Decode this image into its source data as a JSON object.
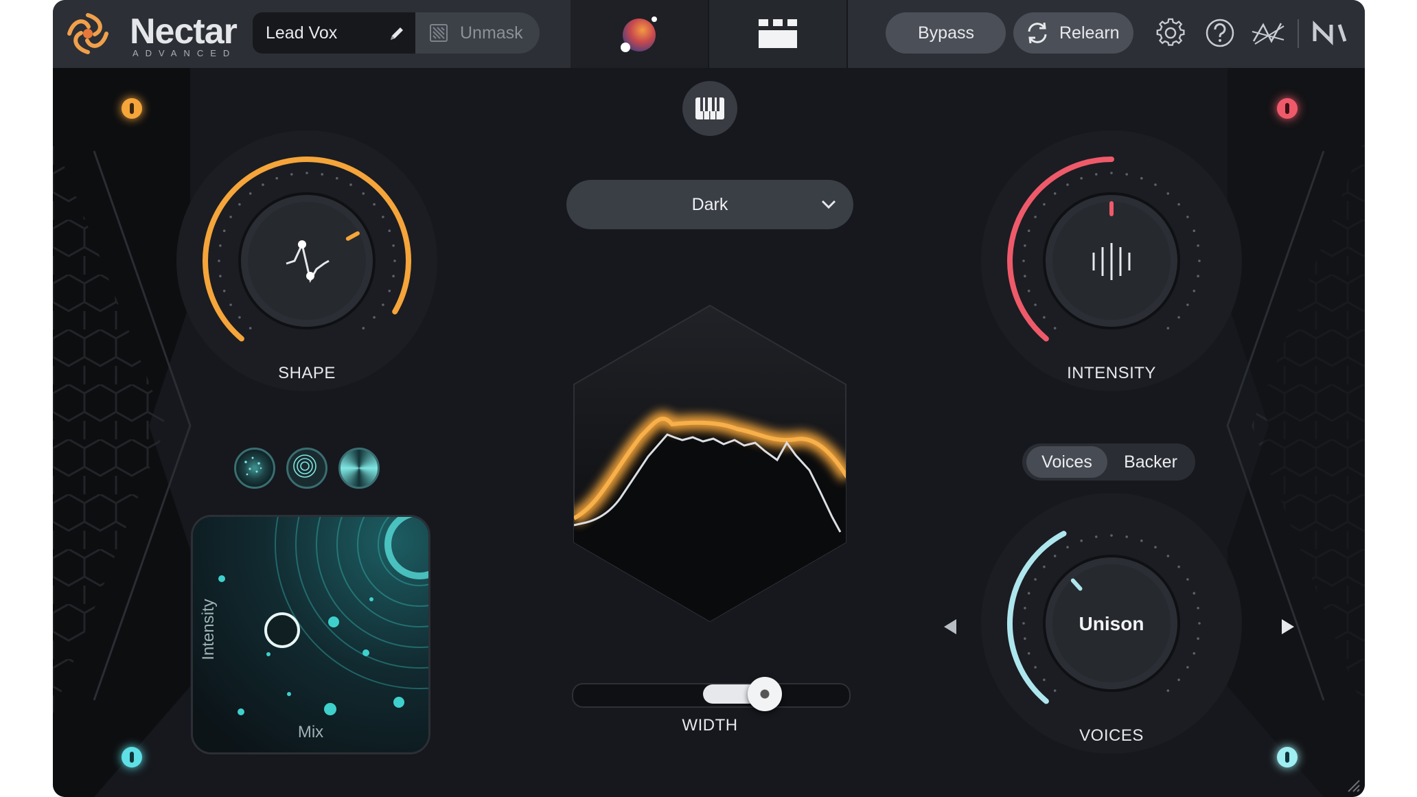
{
  "header": {
    "logo_name": "Nectar",
    "logo_sub": "ADVANCED",
    "preset_name": "Lead Vox",
    "unmask_label": "Unmask",
    "bypass_label": "Bypass",
    "relearn_label": "Relearn",
    "icons": [
      "edit-pencil-icon",
      "unmask-icon",
      "assistant-orb-icon",
      "module-grid-icon",
      "relearn-cycle-icon",
      "gear-icon",
      "help-icon",
      "midi-learn-icon",
      "native-instruments-logo"
    ]
  },
  "shape": {
    "label": "SHAPE",
    "value_fraction": 0.72,
    "color": "#f5a53a"
  },
  "intensity": {
    "label": "INTENSITY",
    "value_fraction": 0.5,
    "color": "#ef5a6a"
  },
  "style": {
    "selected": "Dark"
  },
  "width": {
    "label": "WIDTH",
    "value_fraction": 0.7
  },
  "voices_mode": {
    "options": [
      "Voices",
      "Backer"
    ],
    "selected": "Voices"
  },
  "voices": {
    "label": "VOICES",
    "value": "Unison",
    "value_fraction": 0.35,
    "color": "#aee6ee"
  },
  "xy_pad": {
    "y_label": "Intensity",
    "x_label": "Mix",
    "accent": "#3fd0cc"
  },
  "colors": {
    "corner_top_left": "#f5a53a",
    "corner_top_right": "#ef5a6a",
    "corner_bottom": "#5ee0e6"
  }
}
